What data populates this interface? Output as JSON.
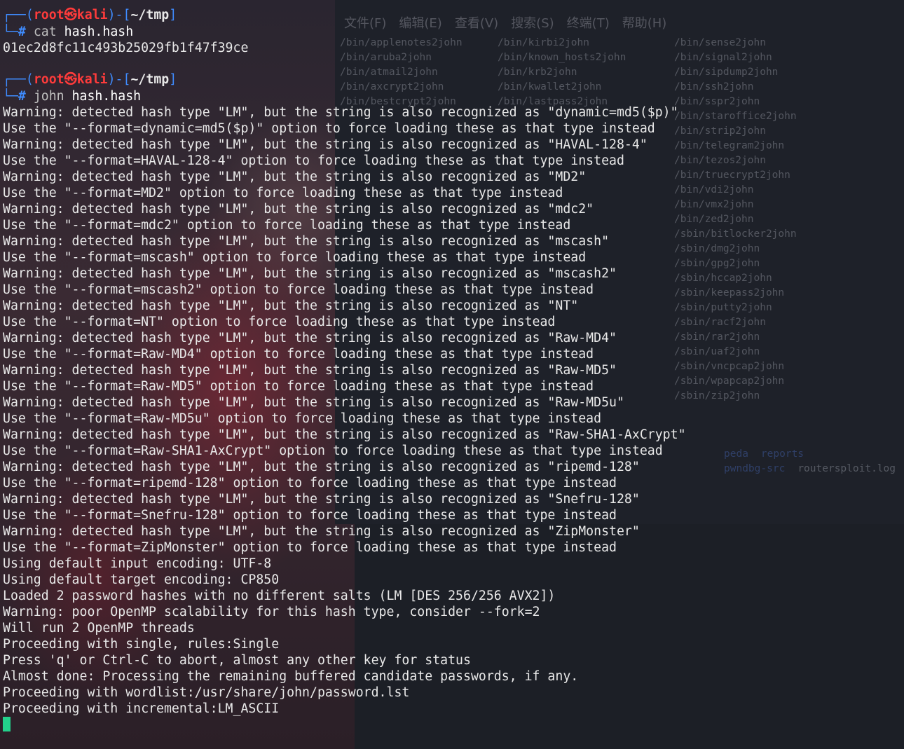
{
  "background_window": {
    "menu": [
      "文件(F)",
      "编辑(E)",
      "查看(V)",
      "搜索(S)",
      "终端(T)",
      "帮助(H)"
    ],
    "col1": [
      "/bin/applenotes2john",
      "/bin/aruba2john",
      "/bin/atmail2john",
      "/bin/axcrypt2john",
      "/bin/bestcrypt2john"
    ],
    "col2": [
      "/bin/kirbi2john",
      "/bin/known_hosts2john",
      "/bin/krb2john",
      "/bin/kwallet2john",
      "/bin/lastpass2john"
    ],
    "col3": [
      "/bin/sense2john",
      "/bin/signal2john",
      "/bin/sipdump2john",
      "/bin/ssh2john",
      "/bin/sspr2john",
      "/bin/staroffice2john",
      "/bin/strip2john",
      "/bin/telegram2john",
      "/bin/tezos2john",
      "/bin/truecrypt2john",
      "/bin/vdi2john",
      "/bin/vmx2john",
      "/bin/zed2john",
      "/sbin/bitlocker2john",
      "/sbin/dmg2john",
      "/sbin/gpg2john",
      "/sbin/hccap2john",
      "/sbin/keepass2john",
      "/sbin/putty2john",
      "/sbin/racf2john",
      "/sbin/rar2john",
      "/sbin/uaf2john",
      "/sbin/vncpcap2john",
      "/sbin/wpapcap2john",
      "/sbin/zip2john"
    ],
    "row2": [
      "peda",
      "reports",
      "pwndbg-src",
      "routersploit.log"
    ]
  },
  "terminal": {
    "prompts": [
      {
        "user": "root㉿kali",
        "path": "~/tmp",
        "cmd": "cat",
        "arg": "hash.hash"
      },
      {
        "user": "root㉿kali",
        "path": "~/tmp",
        "cmd": "john",
        "arg": "hash.hash"
      }
    ],
    "hash_output": "01ec2d8fc11c493b25029fb1f47f39ce",
    "lines": [
      "Warning: detected hash type \"LM\", but the string is also recognized as \"dynamic=md5($p)\"",
      "Use the \"--format=dynamic=md5($p)\" option to force loading these as that type instead",
      "Warning: detected hash type \"LM\", but the string is also recognized as \"HAVAL-128-4\"",
      "Use the \"--format=HAVAL-128-4\" option to force loading these as that type instead",
      "Warning: detected hash type \"LM\", but the string is also recognized as \"MD2\"",
      "Use the \"--format=MD2\" option to force loading these as that type instead",
      "Warning: detected hash type \"LM\", but the string is also recognized as \"mdc2\"",
      "Use the \"--format=mdc2\" option to force loading these as that type instead",
      "Warning: detected hash type \"LM\", but the string is also recognized as \"mscash\"",
      "Use the \"--format=mscash\" option to force loading these as that type instead",
      "Warning: detected hash type \"LM\", but the string is also recognized as \"mscash2\"",
      "Use the \"--format=mscash2\" option to force loading these as that type instead",
      "Warning: detected hash type \"LM\", but the string is also recognized as \"NT\"",
      "Use the \"--format=NT\" option to force loading these as that type instead",
      "Warning: detected hash type \"LM\", but the string is also recognized as \"Raw-MD4\"",
      "Use the \"--format=Raw-MD4\" option to force loading these as that type instead",
      "Warning: detected hash type \"LM\", but the string is also recognized as \"Raw-MD5\"",
      "Use the \"--format=Raw-MD5\" option to force loading these as that type instead",
      "Warning: detected hash type \"LM\", but the string is also recognized as \"Raw-MD5u\"",
      "Use the \"--format=Raw-MD5u\" option to force loading these as that type instead",
      "Warning: detected hash type \"LM\", but the string is also recognized as \"Raw-SHA1-AxCrypt\"",
      "Use the \"--format=Raw-SHA1-AxCrypt\" option to force loading these as that type instead",
      "Warning: detected hash type \"LM\", but the string is also recognized as \"ripemd-128\"",
      "Use the \"--format=ripemd-128\" option to force loading these as that type instead",
      "Warning: detected hash type \"LM\", but the string is also recognized as \"Snefru-128\"",
      "Use the \"--format=Snefru-128\" option to force loading these as that type instead",
      "Warning: detected hash type \"LM\", but the string is also recognized as \"ZipMonster\"",
      "Use the \"--format=ZipMonster\" option to force loading these as that type instead",
      "Using default input encoding: UTF-8",
      "Using default target encoding: CP850",
      "Loaded 2 password hashes with no different salts (LM [DES 256/256 AVX2])",
      "Warning: poor OpenMP scalability for this hash type, consider --fork=2",
      "Will run 2 OpenMP threads",
      "Proceeding with single, rules:Single",
      "Press 'q' or Ctrl-C to abort, almost any other key for status",
      "Almost done: Processing the remaining buffered candidate passwords, if any.",
      "Proceeding with wordlist:/usr/share/john/password.lst",
      "Proceeding with incremental:LM_ASCII"
    ]
  }
}
